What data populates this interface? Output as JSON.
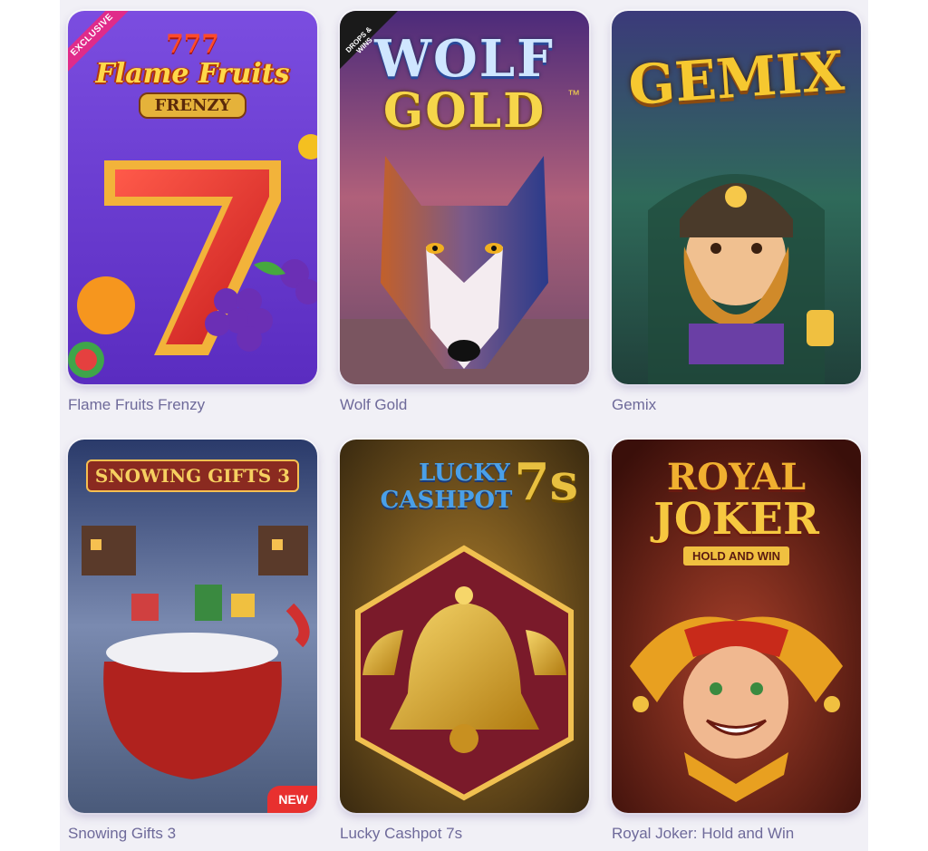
{
  "games": [
    {
      "name": "Flame Fruits Frenzy",
      "logo_line1": "777",
      "logo_line2": "Flame Fruits",
      "logo_line3": "FRENZY",
      "badge": "EXCLUSIVE",
      "theme_color": "#6a3fd0"
    },
    {
      "name": "Wolf Gold",
      "logo_line1": "WOLF",
      "logo_line2": "GOLD",
      "trademark": "™",
      "badge": "DROPS & WINS",
      "theme_color": "#7a4a88"
    },
    {
      "name": "Gemix",
      "logo_line1": "GEMIX",
      "theme_color": "#3b6a5a"
    },
    {
      "name": "Snowing Gifts 3",
      "logo_line1": "SNOWING GIFTS 3",
      "badge": "NEW",
      "theme_color": "#3a4c7a"
    },
    {
      "name": "Lucky Cashpot 7s",
      "logo_line1": "LUCKY",
      "logo_line2": "CASHPOT",
      "logo_line3": "7s",
      "theme_color": "#6b5a1e"
    },
    {
      "name": "Royal Joker: Hold and Win",
      "logo_line1": "ROYAL",
      "logo_line2": "JOKER",
      "logo_line3": "HOLD AND WIN",
      "theme_color": "#5a1f16"
    }
  ]
}
